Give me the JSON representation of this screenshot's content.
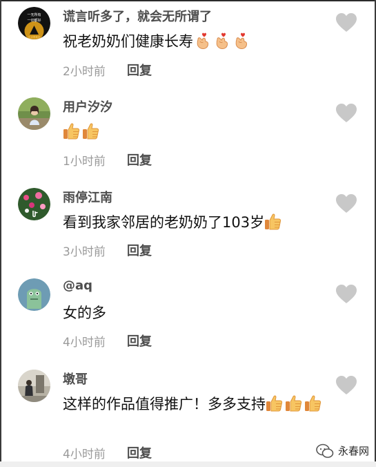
{
  "comments": [
    {
      "username": "谎言听多了，就会无所谓了",
      "text": "祝老奶奶们健康长寿",
      "emoji": [
        "finger-heart-icon",
        "finger-heart-icon",
        "finger-heart-icon"
      ],
      "time": "2小时前",
      "reply_label": "回复",
      "avatar_lines": [
        "一无所有",
        "一切都好",
        "生活很美好"
      ]
    },
    {
      "username": "用户汐汐",
      "text": "",
      "emoji": [
        "thumbs-up-icon",
        "thumbs-up-icon"
      ],
      "time": "1小时前",
      "reply_label": "回复"
    },
    {
      "username": "雨停江南",
      "text": "看到我家邻居的老奶奶了103岁",
      "emoji": [
        "thumbs-up-icon"
      ],
      "time": "3小时前",
      "reply_label": "回复"
    },
    {
      "username": "@aq",
      "text": "女的多",
      "emoji": [],
      "time": "4小时前",
      "reply_label": "回复"
    },
    {
      "username": "墩哥",
      "text": "这样的作品值得推广！多多支持",
      "emoji": [
        "thumbs-up-icon",
        "thumbs-up-icon",
        "thumbs-up-icon"
      ],
      "time": "4小时前",
      "reply_label": "回复"
    }
  ],
  "watermark": {
    "text": "永春网",
    "icon": "wechat-icon"
  },
  "colors": {
    "username": "#4d4d4d",
    "body": "#111111",
    "meta": "#9a9a9a",
    "like": "#c8c8c8",
    "emoji": "#f4b24c"
  }
}
